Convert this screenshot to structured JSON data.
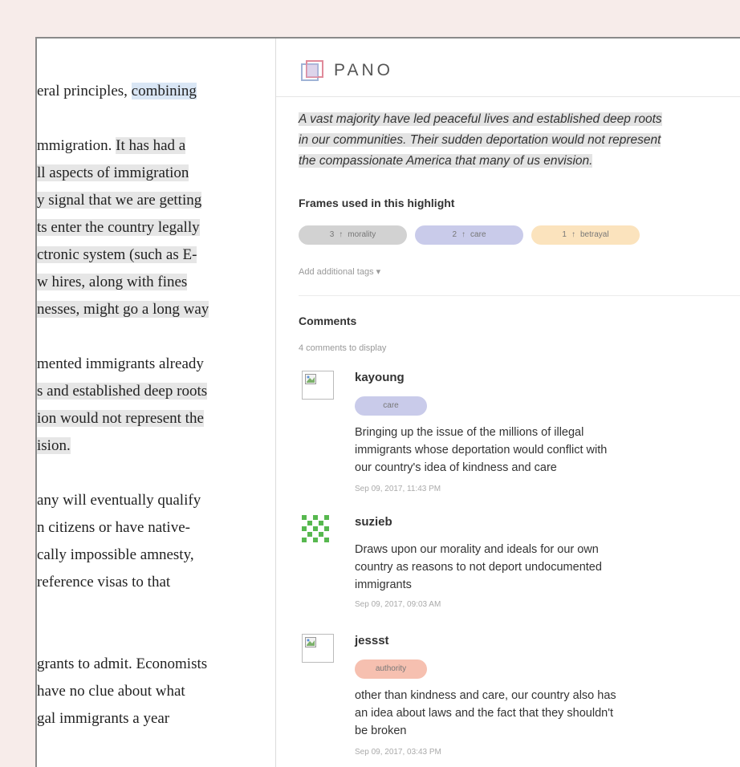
{
  "article": {
    "lines": [
      {
        "parts": [
          {
            "text": "eral principles, ",
            "hl": ""
          },
          {
            "text": "combining",
            "hl": "blue"
          }
        ]
      },
      {
        "parts": [
          {
            "text": "",
            "hl": ""
          }
        ]
      },
      {
        "parts": [
          {
            "text": "mmigration. ",
            "hl": ""
          },
          {
            "text": "It has had a",
            "hl": "grey"
          }
        ]
      },
      {
        "parts": [
          {
            "text": "ll aspects of immigration",
            "hl": "grey"
          }
        ]
      },
      {
        "parts": [
          {
            "text": "y signal that we are getting",
            "hl": "grey"
          }
        ]
      },
      {
        "parts": [
          {
            "text": "ts enter the country legally",
            "hl": "grey"
          }
        ]
      },
      {
        "parts": [
          {
            "text": "ctronic system (such as E-",
            "hl": "grey"
          }
        ]
      },
      {
        "parts": [
          {
            "text": "w hires, along with fines",
            "hl": "grey"
          }
        ]
      },
      {
        "parts": [
          {
            "text": "nesses, might go a long way",
            "hl": "grey"
          }
        ]
      },
      {
        "parts": [
          {
            "text": "",
            "hl": ""
          }
        ]
      },
      {
        "parts": [
          {
            "text": "mented immigrants already",
            "hl": ""
          }
        ]
      },
      {
        "parts": [
          {
            "text": "s and established deep roots",
            "hl": "grey"
          }
        ]
      },
      {
        "parts": [
          {
            "text": "ion would not represent the",
            "hl": "grey"
          }
        ]
      },
      {
        "parts": [
          {
            "text": "ision.",
            "hl": "grey"
          }
        ]
      },
      {
        "parts": [
          {
            "text": "",
            "hl": ""
          }
        ]
      },
      {
        "parts": [
          {
            "text": "any will eventually qualify",
            "hl": ""
          }
        ]
      },
      {
        "parts": [
          {
            "text": "n citizens or have native-",
            "hl": ""
          }
        ]
      },
      {
        "parts": [
          {
            "text": "cally impossible amnesty,",
            "hl": ""
          }
        ]
      },
      {
        "parts": [
          {
            "text": "reference visas to that",
            "hl": ""
          }
        ]
      },
      {
        "parts": [
          {
            "text": "",
            "hl": ""
          }
        ]
      },
      {
        "parts": [
          {
            "text": "",
            "hl": ""
          }
        ]
      },
      {
        "parts": [
          {
            "text": "grants to admit. Economists",
            "hl": ""
          }
        ]
      },
      {
        "parts": [
          {
            "text": " have no clue about what",
            "hl": ""
          }
        ]
      },
      {
        "parts": [
          {
            "text": "gal immigrants a year",
            "hl": ""
          }
        ]
      }
    ]
  },
  "pano": {
    "title": "PANO",
    "quote_lines": [
      "A vast majority have led peaceful lives and established deep roots",
      "in our communities. Their sudden deportation would not represent",
      "the compassionate America that many of us envision."
    ],
    "frames_title": "Frames used in this highlight",
    "frames": [
      {
        "count": "3",
        "label": "morality",
        "color": "#d2d2d2"
      },
      {
        "count": "2",
        "label": "care",
        "color": "#c9cbea"
      },
      {
        "count": "1",
        "label": "betrayal",
        "color": "#fbe3bd"
      }
    ],
    "add_tags": "Add additional tags",
    "comments_title": "Comments",
    "comments_count": "4 comments to display",
    "comments": [
      {
        "user": "kayoung",
        "tag": "care",
        "tag_color": "#c9cbea",
        "text_lines": [
          "Bringing up the issue of the millions of illegal",
          "immigrants whose deportation would conflict with",
          "our country's idea of kindness and care"
        ],
        "date": "Sep 09, 2017, 11:43 PM"
      },
      {
        "user": "suzieb",
        "tag": "",
        "tag_color": "",
        "text_lines": [
          "Draws upon our morality and ideals for our own",
          "country as reasons to not deport undocumented",
          "immigrants"
        ],
        "date": "Sep 09, 2017, 09:03 AM"
      },
      {
        "user": "jessst",
        "tag": "authority",
        "tag_color": "#f6c0b0",
        "text_lines": [
          "other than kindness and care, our country also has",
          "an idea about laws and the fact that they shouldn't",
          "be broken"
        ],
        "date": "Sep 09, 2017, 03:43 PM"
      }
    ]
  }
}
